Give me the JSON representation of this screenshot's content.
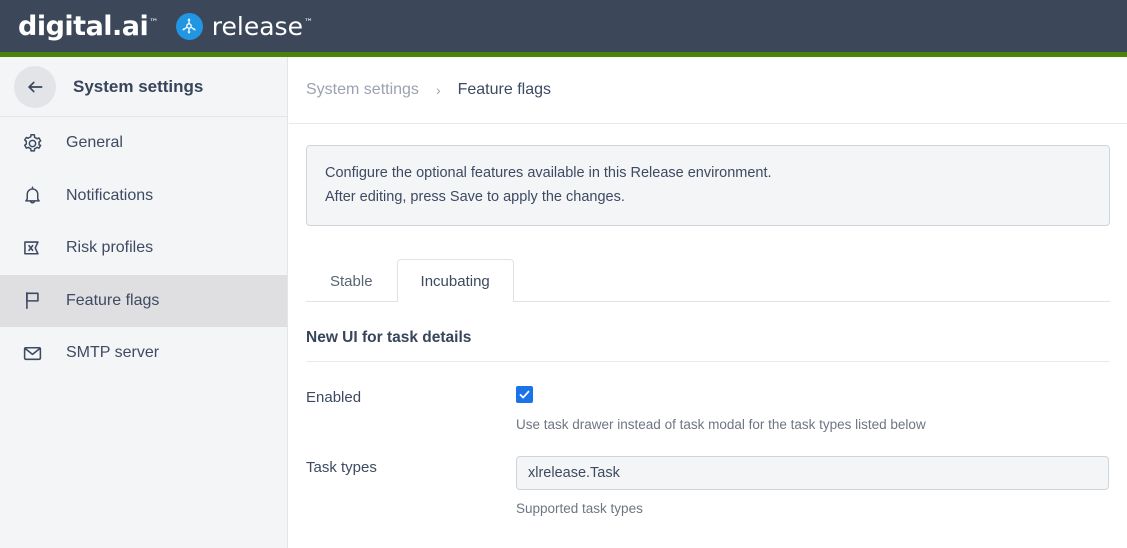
{
  "header": {
    "brand_primary": "digital.ai",
    "brand_tm": "™",
    "brand_product": "release",
    "product_tm": "™",
    "product_icon": "release-network-icon",
    "bg_color": "#3c4859",
    "accent_strip_color": "#4a8309",
    "product_icon_color": "#2196e3"
  },
  "sidebar": {
    "back_icon": "arrow-left-icon",
    "title": "System settings",
    "items": [
      {
        "label": "General",
        "icon": "gear-icon",
        "selected": false
      },
      {
        "label": "Notifications",
        "icon": "bell-icon",
        "selected": false
      },
      {
        "label": "Risk profiles",
        "icon": "risk-profile-icon",
        "selected": false
      },
      {
        "label": "Feature flags",
        "icon": "flag-icon",
        "selected": true
      },
      {
        "label": "SMTP server",
        "icon": "envelope-icon",
        "selected": false
      }
    ],
    "selected_bg_color": "#dfdfe1",
    "bg_color": "#f4f5f7"
  },
  "breadcrumb": {
    "parent": "System settings",
    "separator": "›",
    "current": "Feature flags"
  },
  "info_box": {
    "line1": "Configure the optional features available in this Release environment.",
    "line2": "After editing, press Save to apply the changes."
  },
  "tabs": [
    {
      "label": "Stable",
      "active": false
    },
    {
      "label": "Incubating",
      "active": true
    }
  ],
  "section": {
    "title": "New UI for task details",
    "fields": [
      {
        "label": "Enabled",
        "type": "checkbox",
        "checked": true,
        "checkbox_color": "#1a73e8",
        "help": "Use task drawer instead of task modal for the task types listed below"
      },
      {
        "label": "Task types",
        "type": "text",
        "value": "xlrelease.Task",
        "placeholder": "",
        "help": "Supported task types"
      }
    ]
  }
}
